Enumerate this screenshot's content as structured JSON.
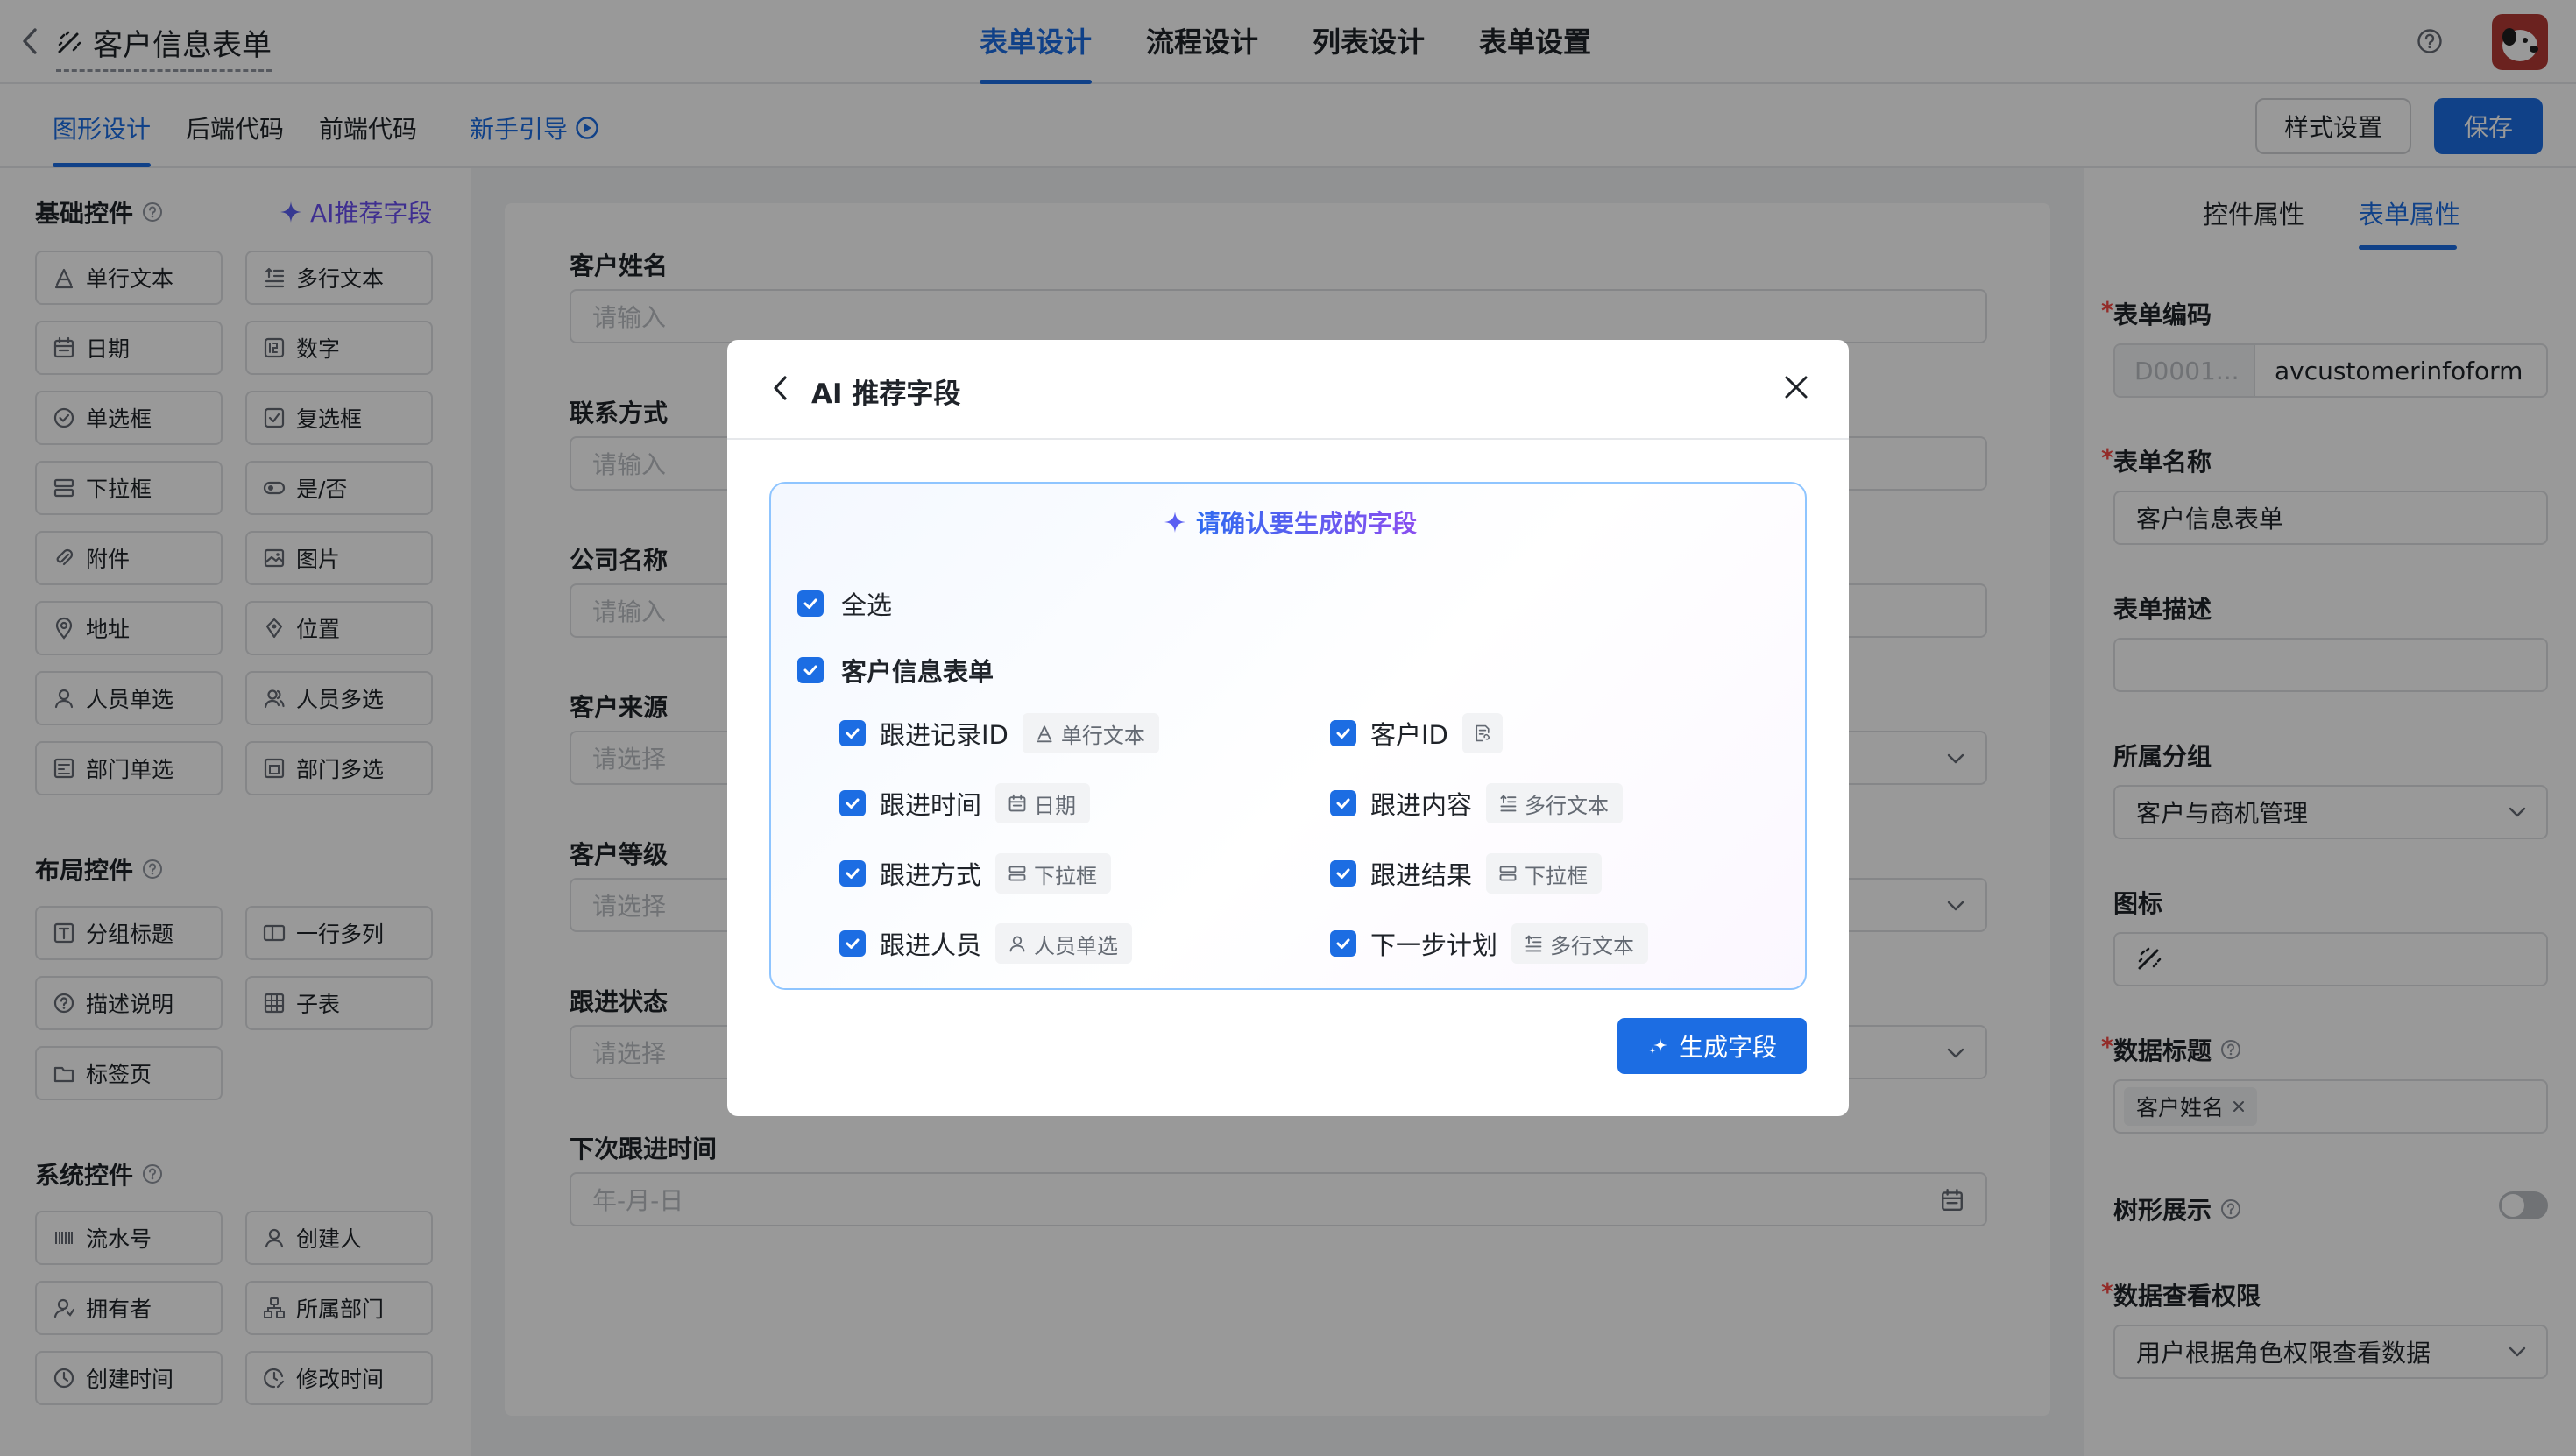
{
  "app": {
    "title": "客户信息表单",
    "tabs": [
      "表单设计",
      "流程设计",
      "列表设计",
      "表单设置"
    ],
    "subtabs": [
      "图形设计",
      "后端代码",
      "前端代码"
    ],
    "guide_label": "新手引导",
    "style_btn": "样式设置",
    "save_btn": "保存"
  },
  "left_panel": {
    "basic_title": "基础控件",
    "ai_recommend": "AI推荐字段",
    "basic_controls": [
      {
        "label": "单行文本",
        "icon": "text-a-icon"
      },
      {
        "label": "多行文本",
        "icon": "multiline-icon"
      },
      {
        "label": "日期",
        "icon": "calendar-icon"
      },
      {
        "label": "数字",
        "icon": "number-icon"
      },
      {
        "label": "单选框",
        "icon": "radio-icon"
      },
      {
        "label": "复选框",
        "icon": "checkbox-icon"
      },
      {
        "label": "下拉框",
        "icon": "dropdown-icon"
      },
      {
        "label": "是/否",
        "icon": "toggle-icon"
      },
      {
        "label": "附件",
        "icon": "attachment-icon"
      },
      {
        "label": "图片",
        "icon": "image-icon"
      },
      {
        "label": "地址",
        "icon": "address-icon"
      },
      {
        "label": "位置",
        "icon": "location-icon"
      },
      {
        "label": "人员单选",
        "icon": "user-icon"
      },
      {
        "label": "人员多选",
        "icon": "users-icon"
      },
      {
        "label": "部门单选",
        "icon": "dept-icon"
      },
      {
        "label": "部门多选",
        "icon": "depts-icon"
      }
    ],
    "layout_title": "布局控件",
    "layout_controls": [
      {
        "label": "分组标题",
        "icon": "group-title-icon"
      },
      {
        "label": "一行多列",
        "icon": "columns-icon"
      },
      {
        "label": "描述说明",
        "icon": "help-icon"
      },
      {
        "label": "子表",
        "icon": "table-icon"
      },
      {
        "label": "标签页",
        "icon": "tabs-icon"
      }
    ],
    "system_title": "系统控件",
    "system_controls": [
      {
        "label": "流水号",
        "icon": "serial-icon"
      },
      {
        "label": "创建人",
        "icon": "creator-icon"
      },
      {
        "label": "拥有者",
        "icon": "owner-icon"
      },
      {
        "label": "所属部门",
        "icon": "org-icon"
      },
      {
        "label": "创建时间",
        "icon": "clock-icon"
      },
      {
        "label": "修改时间",
        "icon": "clock-edit-icon"
      }
    ]
  },
  "form": {
    "fields": [
      {
        "label": "客户姓名",
        "placeholder": "请输入",
        "kind": "input"
      },
      {
        "label": "联系方式",
        "placeholder": "请输入",
        "kind": "input"
      },
      {
        "label": "公司名称",
        "placeholder": "请输入",
        "kind": "input"
      },
      {
        "label": "客户来源",
        "placeholder": "请选择",
        "kind": "select"
      },
      {
        "label": "客户等级",
        "placeholder": "请选择",
        "kind": "select"
      },
      {
        "label": "跟进状态",
        "placeholder": "请选择",
        "kind": "select"
      },
      {
        "label": "下次跟进时间",
        "placeholder": "年-月-日",
        "kind": "date"
      }
    ]
  },
  "right_panel": {
    "tabs": [
      "控件属性",
      "表单属性"
    ],
    "code_label": "表单编码",
    "code_prefix": "D0001...",
    "code_value": "avcustomerinfoform",
    "name_label": "表单名称",
    "name_value": "客户信息表单",
    "desc_label": "表单描述",
    "group_label": "所属分组",
    "group_value": "客户与商机管理",
    "icon_label": "图标",
    "data_title_label": "数据标题",
    "data_title_tag": "客户姓名",
    "tree_label": "树形展示",
    "perm_label": "数据查看权限",
    "perm_value": "用户根据角色权限查看数据"
  },
  "modal": {
    "title": "AI 推荐字段",
    "confirm_text": "请确认要生成的字段",
    "select_all": "全选",
    "form_name": "客户信息表单",
    "fields": [
      {
        "label": "跟进记录ID",
        "type": "单行文本",
        "icon": "text-a-icon",
        "checked": true
      },
      {
        "label": "客户ID",
        "type": "",
        "icon": "relation-icon",
        "checked": true
      },
      {
        "label": "跟进时间",
        "type": "日期",
        "icon": "calendar-icon",
        "checked": true
      },
      {
        "label": "跟进内容",
        "type": "多行文本",
        "icon": "multiline-icon",
        "checked": true
      },
      {
        "label": "跟进方式",
        "type": "下拉框",
        "icon": "dropdown-icon",
        "checked": true
      },
      {
        "label": "跟进结果",
        "type": "下拉框",
        "icon": "dropdown-icon",
        "checked": true
      },
      {
        "label": "跟进人员",
        "type": "人员单选",
        "icon": "user-icon",
        "checked": true
      },
      {
        "label": "下一步计划",
        "type": "多行文本",
        "icon": "multiline-icon",
        "checked": true
      }
    ],
    "generate_btn": "生成字段"
  }
}
